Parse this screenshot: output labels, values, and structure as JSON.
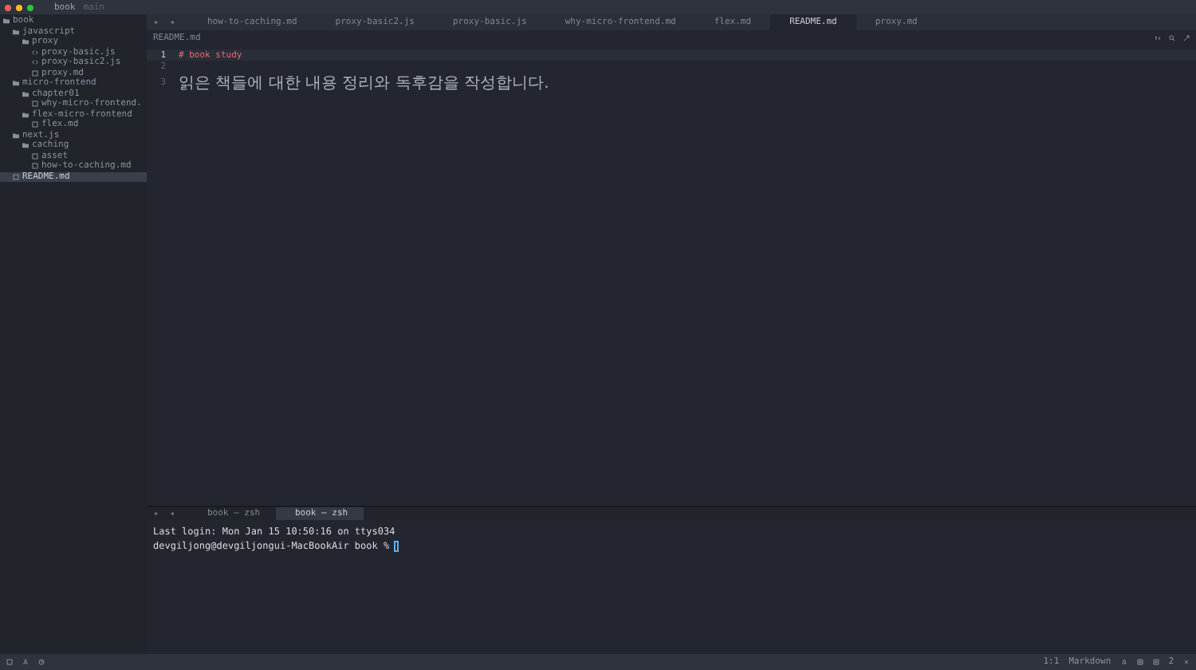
{
  "window": {
    "title": "book",
    "branch": "main"
  },
  "sidebar": {
    "tree": [
      {
        "label": "book",
        "kind": "folder",
        "selected": false,
        "children": [
          {
            "label": "javascript",
            "kind": "folder",
            "selected": false,
            "children": [
              {
                "label": "proxy",
                "kind": "folder",
                "selected": false,
                "children": [
                  {
                    "label": "proxy-basic.js",
                    "kind": "script",
                    "selected": false
                  },
                  {
                    "label": "proxy-basic2.js",
                    "kind": "script",
                    "selected": false
                  },
                  {
                    "label": "proxy.md",
                    "kind": "doc",
                    "selected": false
                  }
                ]
              }
            ]
          },
          {
            "label": "micro-frontend",
            "kind": "folder",
            "selected": false,
            "children": [
              {
                "label": "chapter01",
                "kind": "folder",
                "selected": false,
                "children": [
                  {
                    "label": "why-micro-frontend.",
                    "kind": "doc",
                    "selected": false
                  }
                ]
              },
              {
                "label": "flex-micro-frontend",
                "kind": "folder",
                "selected": false,
                "children": [
                  {
                    "label": "flex.md",
                    "kind": "doc",
                    "selected": false
                  }
                ]
              }
            ]
          },
          {
            "label": "next.js",
            "kind": "folder",
            "selected": false,
            "children": [
              {
                "label": "caching",
                "kind": "folder",
                "selected": false,
                "children": [
                  {
                    "label": "asset",
                    "kind": "doc",
                    "selected": false
                  },
                  {
                    "label": "how-to-caching.md",
                    "kind": "doc",
                    "selected": false
                  }
                ]
              }
            ]
          },
          {
            "label": "README.md",
            "kind": "doc",
            "selected": true
          }
        ]
      }
    ]
  },
  "tabs": [
    {
      "label": "how-to-caching.md",
      "selected": false
    },
    {
      "label": "proxy-basic2.js",
      "selected": false
    },
    {
      "label": "proxy-basic.js",
      "selected": false
    },
    {
      "label": "why-micro-frontend.md",
      "selected": false
    },
    {
      "label": "flex.md",
      "selected": false
    },
    {
      "label": "README.md",
      "selected": true
    },
    {
      "label": "proxy.md",
      "selected": false
    }
  ],
  "editor": {
    "breadcrumb": "README.md",
    "lines": [
      {
        "number": "1",
        "text": "# book study",
        "kind": "heading"
      },
      {
        "number": "2"
      },
      {
        "number": "3",
        "text": "읽은 책들에 대한 내용 정리와 독후감을 작성합니다.",
        "kind": "text"
      }
    ]
  },
  "terminal": {
    "tabs": [
      {
        "label": "book — zsh",
        "selected": false
      },
      {
        "label": "book — zsh",
        "selected": true
      }
    ],
    "lines": [
      "Last login: Mon Jan 15 10:50:16 on ttys034",
      "devgiljong@devgiljongui-MacBookAir book %"
    ]
  },
  "status_bar": {
    "position": "1:1",
    "language": "Markdown",
    "count": "2"
  }
}
